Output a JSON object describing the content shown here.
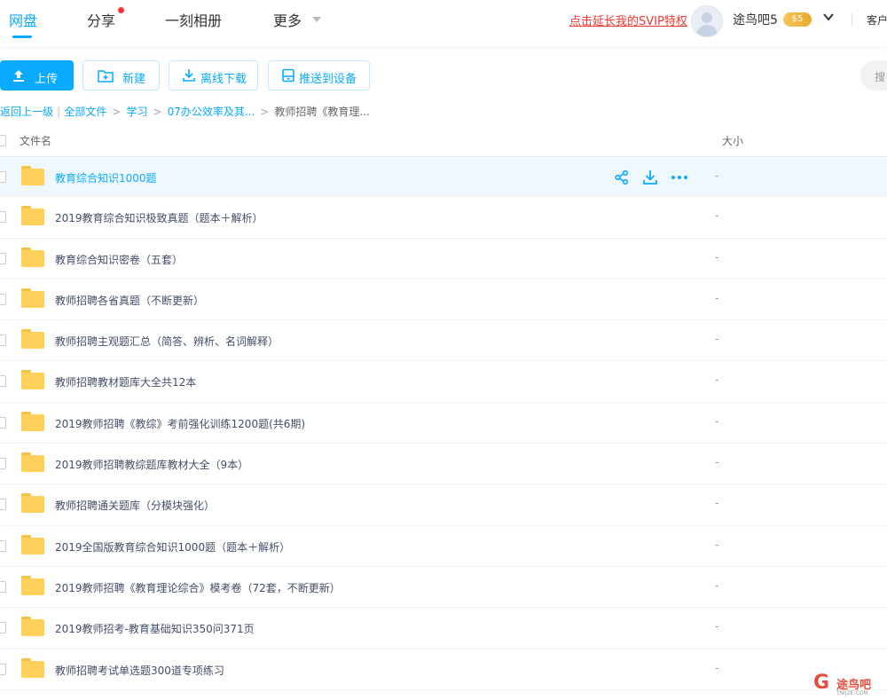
{
  "nav": {
    "tabs": [
      "网盘",
      "分享",
      "一刻相册",
      "更多"
    ],
    "svip_link": "点击延长我的SVIP特权",
    "username": "途鸟吧5",
    "vip_level": "5",
    "client": "客户"
  },
  "toolbar": {
    "upload": "上传",
    "new": "新建",
    "offline_download": "离线下载",
    "push_device": "推送到设备",
    "search_placeholder": "搜"
  },
  "breadcrumb": {
    "back": "返回上一级",
    "all_files": "全部文件",
    "items": [
      "学习",
      "07办公效率及其...",
      "教师招聘《教育理..."
    ]
  },
  "table": {
    "col_name": "文件名",
    "col_size": "大小",
    "rows": [
      {
        "name": "教育综合知识1000题",
        "size": "-"
      },
      {
        "name": "2019教育综合知识极致真题（题本＋解析）",
        "size": "-"
      },
      {
        "name": "教育综合知识密卷（五套）",
        "size": "-"
      },
      {
        "name": "教师招聘各省真题（不断更新）",
        "size": "-"
      },
      {
        "name": "教师招聘主观题汇总（简答、辨析、名词解释）",
        "size": "-"
      },
      {
        "name": "教师招聘教材题库大全共12本",
        "size": "-"
      },
      {
        "name": "2019教师招聘《教综》考前强化训练1200题(共6期)",
        "size": "-"
      },
      {
        "name": "2019教师招聘教综题库教材大全（9本）",
        "size": "-"
      },
      {
        "name": "教师招聘通关题库（分模块强化）",
        "size": "-"
      },
      {
        "name": "2019全国版教育综合知识1000题（题本＋解析）",
        "size": "-"
      },
      {
        "name": "2019教师招聘《教育理论综合》模考卷（72套，不断更新）",
        "size": "-"
      },
      {
        "name": "2019教师招考-教育基础知识350问371页",
        "size": "-"
      },
      {
        "name": "教师招聘考试单选题300道专项练习",
        "size": "-"
      }
    ]
  },
  "watermark": {
    "title": "途鸟吧",
    "sub": "TNIJZE.COM"
  },
  "colors": {
    "accent": "#09aaff",
    "svip": "#f0372f",
    "folder": "#ffd15b"
  }
}
